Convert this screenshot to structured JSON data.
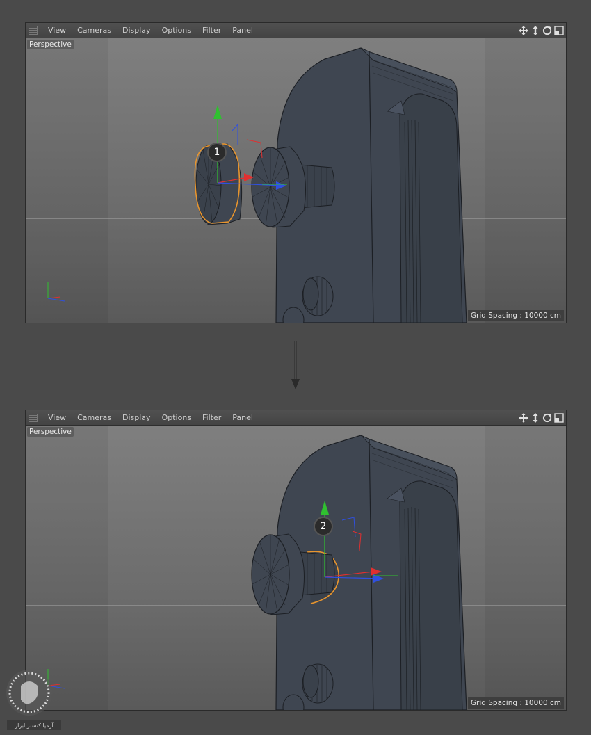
{
  "menu": {
    "items": [
      "View",
      "Cameras",
      "Display",
      "Options",
      "Filter",
      "Panel"
    ]
  },
  "icons": [
    "move-view-icon",
    "dolly-view-icon",
    "rotate-view-icon",
    "maximize-view-icon"
  ],
  "viewport": {
    "camera_label": "Perspective",
    "grid_spacing": "Grid Spacing : 10000 cm"
  },
  "steps": {
    "first": "1",
    "second": "2"
  },
  "colors": {
    "background": "#4a4a4a",
    "selection": "#e8952e",
    "axis_x": "#e03030",
    "axis_y": "#30c030",
    "axis_z": "#3050e0",
    "model": "#3f4651"
  },
  "watermark": {
    "text": "آرمیا کنستر ابزار"
  }
}
